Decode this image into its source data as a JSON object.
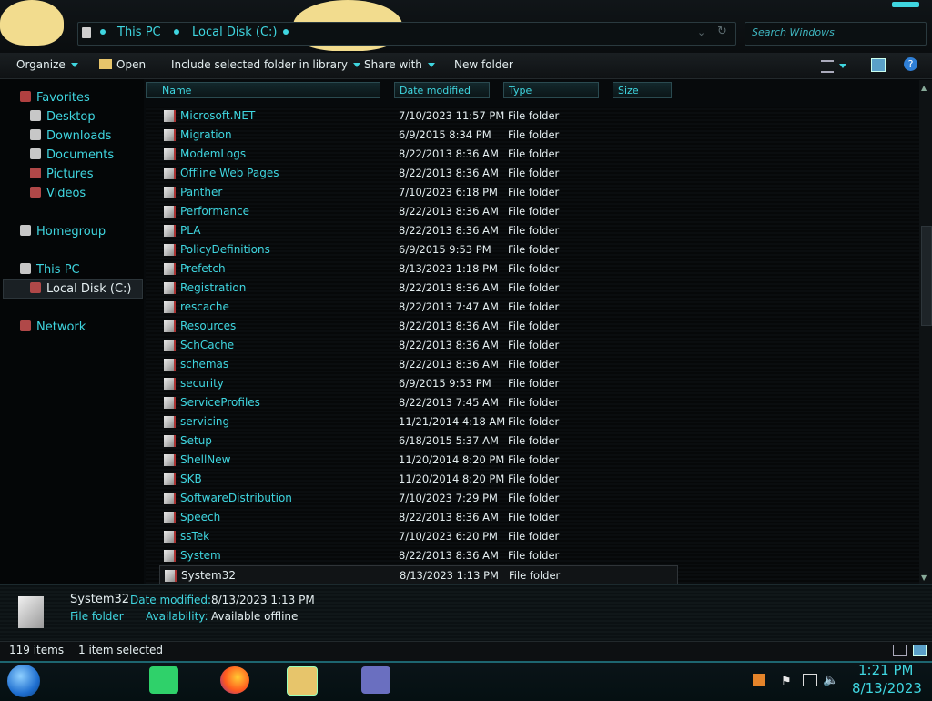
{
  "address": {
    "crumbs": [
      "This PC",
      "Local Disk (C:)"
    ],
    "search_placeholder": "Search Windows"
  },
  "toolbar": {
    "organize": "Organize",
    "open": "Open",
    "include": "Include selected folder in library",
    "share": "Share with",
    "new_folder": "New folder"
  },
  "nav": {
    "favorites": "Favorites",
    "desktop": "Desktop",
    "downloads": "Downloads",
    "documents": "Documents",
    "pictures": "Pictures",
    "videos": "Videos",
    "homegroup": "Homegroup",
    "this_pc": "This PC",
    "local_disk": "Local Disk (C:)",
    "network": "Network"
  },
  "columns": {
    "name": "Name",
    "date": "Date modified",
    "type": "Type",
    "size": "Size"
  },
  "files": [
    {
      "name": "Microsoft.NET",
      "date": "7/10/2023 11:57 PM",
      "type": "File folder"
    },
    {
      "name": "Migration",
      "date": "6/9/2015 8:34 PM",
      "type": "File folder"
    },
    {
      "name": "ModemLogs",
      "date": "8/22/2013 8:36 AM",
      "type": "File folder"
    },
    {
      "name": "Offline Web Pages",
      "date": "8/22/2013 8:36 AM",
      "type": "File folder"
    },
    {
      "name": "Panther",
      "date": "7/10/2023 6:18 PM",
      "type": "File folder"
    },
    {
      "name": "Performance",
      "date": "8/22/2013 8:36 AM",
      "type": "File folder"
    },
    {
      "name": "PLA",
      "date": "8/22/2013 8:36 AM",
      "type": "File folder"
    },
    {
      "name": "PolicyDefinitions",
      "date": "6/9/2015 9:53 PM",
      "type": "File folder"
    },
    {
      "name": "Prefetch",
      "date": "8/13/2023 1:18 PM",
      "type": "File folder"
    },
    {
      "name": "Registration",
      "date": "8/22/2013 8:36 AM",
      "type": "File folder"
    },
    {
      "name": "rescache",
      "date": "8/22/2013 7:47 AM",
      "type": "File folder"
    },
    {
      "name": "Resources",
      "date": "8/22/2013 8:36 AM",
      "type": "File folder"
    },
    {
      "name": "SchCache",
      "date": "8/22/2013 8:36 AM",
      "type": "File folder"
    },
    {
      "name": "schemas",
      "date": "8/22/2013 8:36 AM",
      "type": "File folder"
    },
    {
      "name": "security",
      "date": "6/9/2015 9:53 PM",
      "type": "File folder"
    },
    {
      "name": "ServiceProfiles",
      "date": "8/22/2013 7:45 AM",
      "type": "File folder"
    },
    {
      "name": "servicing",
      "date": "11/21/2014 4:18 AM",
      "type": "File folder"
    },
    {
      "name": "Setup",
      "date": "6/18/2015 5:37 AM",
      "type": "File folder"
    },
    {
      "name": "ShellNew",
      "date": "11/20/2014 8:20 PM",
      "type": "File folder"
    },
    {
      "name": "SKB",
      "date": "11/20/2014 8:20 PM",
      "type": "File folder"
    },
    {
      "name": "SoftwareDistribution",
      "date": "7/10/2023 7:29 PM",
      "type": "File folder"
    },
    {
      "name": "Speech",
      "date": "8/22/2013 8:36 AM",
      "type": "File folder"
    },
    {
      "name": "ssTek",
      "date": "7/10/2023 6:20 PM",
      "type": "File folder"
    },
    {
      "name": "System",
      "date": "8/22/2013 8:36 AM",
      "type": "File folder"
    },
    {
      "name": "System32",
      "date": "8/13/2023 1:13 PM",
      "type": "File folder"
    }
  ],
  "details": {
    "name": "System32",
    "date_label": "Date modified:",
    "date_value": "8/13/2023 1:13 PM",
    "type": "File folder",
    "avail_label": "Availability:",
    "avail_value": "Available offline"
  },
  "status": {
    "count": "119 items",
    "selected": "1 item selected"
  },
  "clock": {
    "time": "1:21 PM",
    "date": "8/13/2023"
  },
  "colors": {
    "accent": "#3fd6e0",
    "background": "#070a0c"
  }
}
